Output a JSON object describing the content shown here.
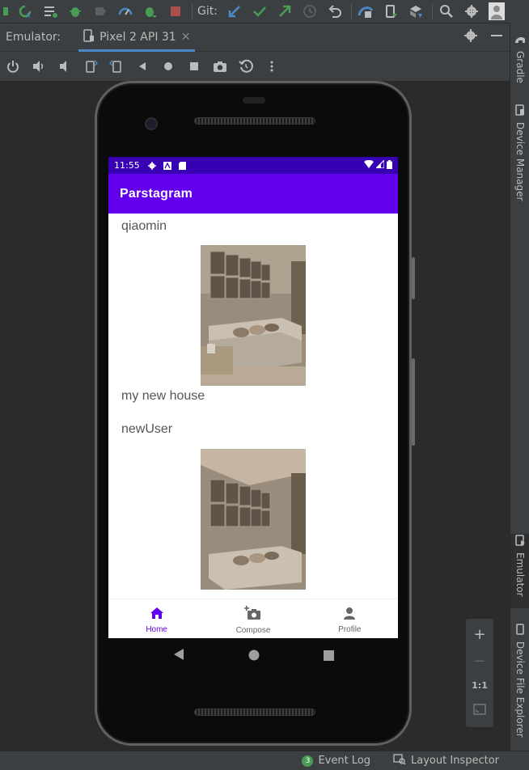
{
  "toolbar": {
    "git_label": "Git:",
    "icons": [
      "build-icon",
      "sync-icon",
      "list-icon",
      "debug-icon",
      "attach-debugger-icon",
      "profiler-icon",
      "apply-changes-icon",
      "stop-icon",
      "git-update-icon",
      "git-commit-icon",
      "git-push-icon",
      "history-icon",
      "rollback-icon",
      "avd-manager-icon",
      "sdk-manager-icon",
      "device-manager-icon",
      "search-icon",
      "settings-icon",
      "account-icon"
    ]
  },
  "tabs": {
    "emulator_label": "Emulator:",
    "device_tab": "Pixel 2 API 31",
    "close": "✕"
  },
  "right_strip": {
    "gradle": "Gradle",
    "device_manager": "Device Manager",
    "emulator": "Emulator",
    "file_explorer": "Device File Explorer"
  },
  "phone": {
    "status_time": "11:55",
    "app_title": "Parstagram",
    "posts": [
      {
        "user": "qiaomin",
        "description": "my new house"
      },
      {
        "user": "newUser",
        "description": ""
      }
    ],
    "bottom_nav": [
      {
        "label": "Home",
        "icon": "home-icon",
        "active": true
      },
      {
        "label": "Compose",
        "icon": "camera-add-icon",
        "active": false
      },
      {
        "label": "Profile",
        "icon": "person-icon",
        "active": false
      }
    ]
  },
  "zoom": {
    "plus": "+",
    "minus": "−",
    "one_to_one": "1:1"
  },
  "footer": {
    "event_log_count": "3",
    "event_log": "Event Log",
    "layout_inspector": "Layout Inspector"
  },
  "colors": {
    "accent": "#6200ee",
    "status_bar": "#3700b3",
    "ide_bg": "#2b2b2b",
    "panel_bg": "#3c3f41"
  }
}
